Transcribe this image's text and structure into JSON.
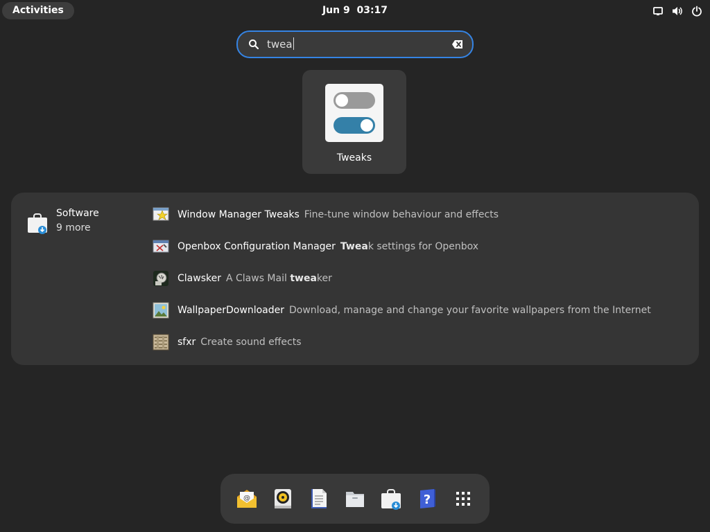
{
  "topbar": {
    "activities": "Activities",
    "date": "Jun 9",
    "time": "03:17",
    "tray_icons": [
      "display-icon",
      "volume-icon",
      "power-icon"
    ]
  },
  "search": {
    "query": "twea"
  },
  "app_results": [
    {
      "name": "Tweaks",
      "icon": "tweaks-icon"
    }
  ],
  "provider": {
    "name": "Software",
    "more": "9 more",
    "icon": "software-icon",
    "results": [
      {
        "title": "Window Manager Tweaks",
        "desc_pre": "Fine-tune window behaviour and effects",
        "desc_bold": "",
        "desc_post": "",
        "icon": "window-manager-tweaks-icon"
      },
      {
        "title": "Openbox Configuration Manager",
        "desc_pre": "",
        "desc_bold": "Twea",
        "desc_post": "k settings for Openbox",
        "icon": "openbox-config-icon"
      },
      {
        "title": "Clawsker",
        "desc_pre": "A Claws Mail ",
        "desc_bold": "twea",
        "desc_post": "ker",
        "icon": "clawsker-icon"
      },
      {
        "title": "WallpaperDownloader",
        "desc_pre": "Download, manage and change your favorite wallpapers from the Internet",
        "desc_bold": "",
        "desc_post": "",
        "icon": "wallpaper-downloader-icon"
      },
      {
        "title": "sfxr",
        "desc_pre": "Create sound effects",
        "desc_bold": "",
        "desc_post": "",
        "icon": "sfxr-icon"
      }
    ]
  },
  "dash": [
    "mail-icon",
    "music-player-icon",
    "text-editor-icon",
    "files-icon",
    "software-icon",
    "help-icon",
    "show-apps-icon"
  ],
  "colors": {
    "accent": "#3584e4",
    "background": "#252525",
    "panel": "#353535",
    "tweaks_toggle": "#3480a8"
  }
}
